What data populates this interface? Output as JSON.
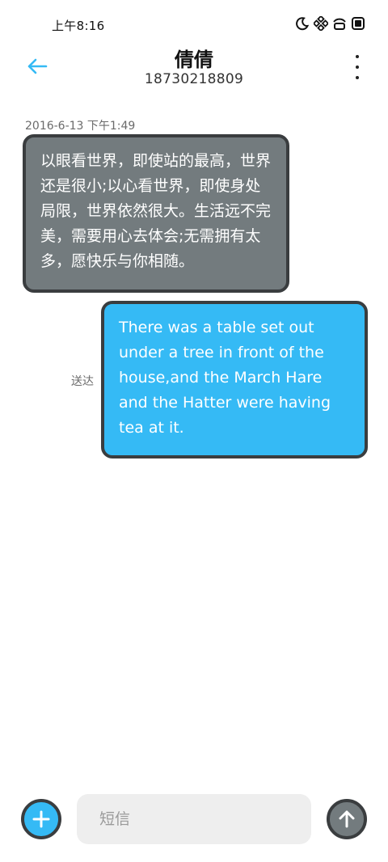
{
  "status_bar": {
    "time": "上午8:16",
    "icons": [
      "moon-icon",
      "dots-icon",
      "wifi-icon",
      "battery-icon"
    ]
  },
  "header": {
    "back_icon": "back-arrow-icon",
    "contact_name": "倩倩",
    "contact_number": "18730218809",
    "more_icon": "more-vertical-icon"
  },
  "conversation": {
    "timestamp": "2016-6-13 下午1:49",
    "messages": [
      {
        "direction": "received",
        "text": "以眼看世界，即使站的最高，世界还是很小;以心看世界，即使身处局限，世界依然很大。生活远不完美，需要用心去体会;无需拥有太多，愿快乐与你相随。"
      },
      {
        "direction": "sent",
        "text": "There was a table set out under a tree in front of the house,and the March Hare and the Hatter were having tea at it.",
        "status": "送达"
      }
    ]
  },
  "composer": {
    "placeholder": "短信",
    "value": "",
    "add_icon": "plus-icon",
    "send_icon": "arrow-up-icon"
  },
  "colors": {
    "accent": "#35baf5",
    "received_bubble": "#737b7e",
    "border": "#3a3d3f"
  }
}
